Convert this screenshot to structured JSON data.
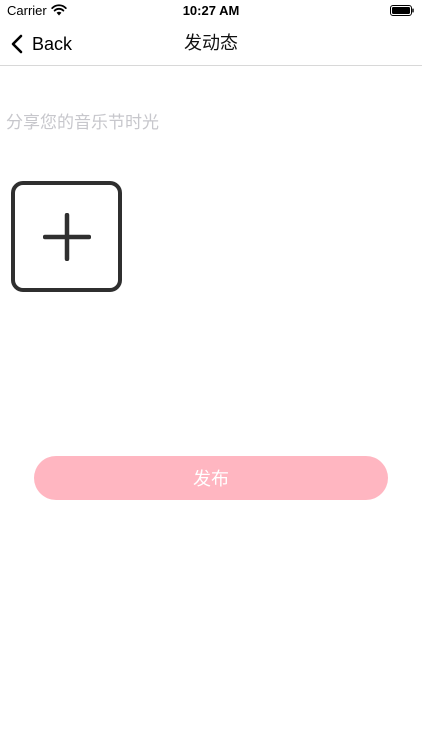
{
  "status_bar": {
    "carrier": "Carrier",
    "time": "10:27 AM",
    "icons": [
      "wifi-icon",
      "battery-icon"
    ]
  },
  "nav": {
    "back_label": "Back",
    "title": "发动态",
    "icons": [
      "chevron-left-icon"
    ]
  },
  "post": {
    "input_value": "",
    "input_placeholder": "分享您的音乐节时光",
    "add_photo_icon": "plus-icon",
    "publish_label": "发布"
  },
  "colors": {
    "publish_button_bg": "#ffb6c1",
    "publish_button_text": "#ffffff",
    "placeholder": "#c7c7cc",
    "add_photo_border": "#2f2f2f",
    "divider": "#d8d8d8"
  }
}
